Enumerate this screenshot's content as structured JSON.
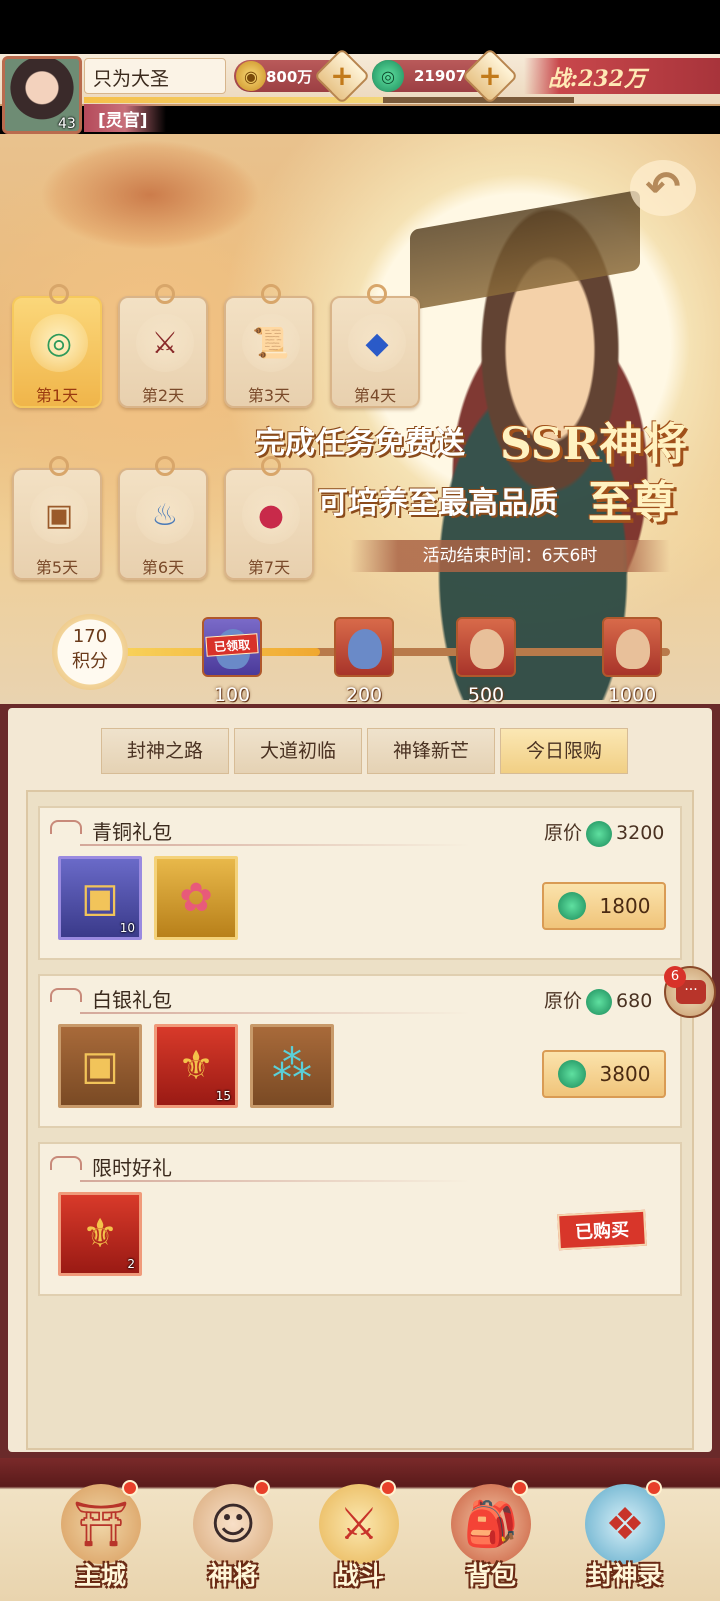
{
  "header": {
    "avatar_level": "43",
    "player_name": "只为大圣",
    "title": "[灵官]",
    "exp_fraction": 0.61,
    "coins": "800万",
    "jade": "21907",
    "power": "战:232万",
    "plus_label": "+"
  },
  "banner": {
    "back_glyph": "↶",
    "days": [
      {
        "label": "第1天",
        "icon": "jade-ring-icon",
        "glyph": "◎",
        "active": true
      },
      {
        "label": "第2天",
        "icon": "weapon-icon",
        "glyph": "⚔",
        "active": false
      },
      {
        "label": "第3天",
        "icon": "scroll-icon",
        "glyph": "📜",
        "active": false
      },
      {
        "label": "第4天",
        "icon": "gem-box-icon",
        "glyph": "◆",
        "active": false
      },
      {
        "label": "第5天",
        "icon": "treasure-chest-icon",
        "glyph": "▣",
        "active": false
      },
      {
        "label": "第6天",
        "icon": "gourd-icon",
        "glyph": "♨",
        "active": false
      },
      {
        "label": "第7天",
        "icon": "orb-icon",
        "glyph": "●",
        "active": false
      }
    ],
    "promo_line1": "完成任务免费送",
    "promo_ssr": "SSR神将",
    "promo_line2": "可培养至最高品质",
    "promo_supreme": "至尊",
    "event_timer": "活动结束时间：6天6时"
  },
  "progress": {
    "score_value": "170",
    "score_label": "积分",
    "milestones": [
      {
        "label": "100",
        "claimed_tag": "已领取"
      },
      {
        "label": "200"
      },
      {
        "label": "500"
      },
      {
        "label": "1000"
      }
    ]
  },
  "tabs": [
    "封神之路",
    "大道初临",
    "神锋新芒",
    "今日限购"
  ],
  "active_tab": "今日限购",
  "packs": [
    {
      "title": "青铜礼包",
      "orig_label": "原价",
      "orig_price": "3200",
      "price": "1800",
      "items": [
        {
          "icon": "treasure-chest-icon",
          "count": "10"
        },
        {
          "icon": "scroll-icon",
          "count": ""
        }
      ]
    },
    {
      "title": "白银礼包",
      "orig_label": "原价",
      "orig_price": "680",
      "price": "3800",
      "items": [
        {
          "icon": "treasure-chest-icon",
          "count": ""
        },
        {
          "icon": "talisman-icon",
          "count": "15"
        },
        {
          "icon": "jade-bead-tray-icon",
          "count": ""
        }
      ]
    },
    {
      "title": "限时好礼",
      "purchased": "已购买",
      "items": [
        {
          "icon": "talisman-icon",
          "count": "2"
        }
      ]
    }
  ],
  "chat": {
    "badge": "6",
    "glyph": "···"
  },
  "nav": [
    {
      "label": "主城",
      "icon": "city-gate-icon",
      "glyph": "⛩",
      "dot": true
    },
    {
      "label": "神将",
      "icon": "hero-icon",
      "glyph": "☺",
      "dot": true
    },
    {
      "label": "战斗",
      "icon": "crossed-swords-icon",
      "glyph": "⚔",
      "dot": true
    },
    {
      "label": "背包",
      "icon": "backpack-icon",
      "glyph": "🎒",
      "dot": true
    },
    {
      "label": "封神录",
      "icon": "record-icon",
      "glyph": "❖",
      "dot": true
    }
  ]
}
